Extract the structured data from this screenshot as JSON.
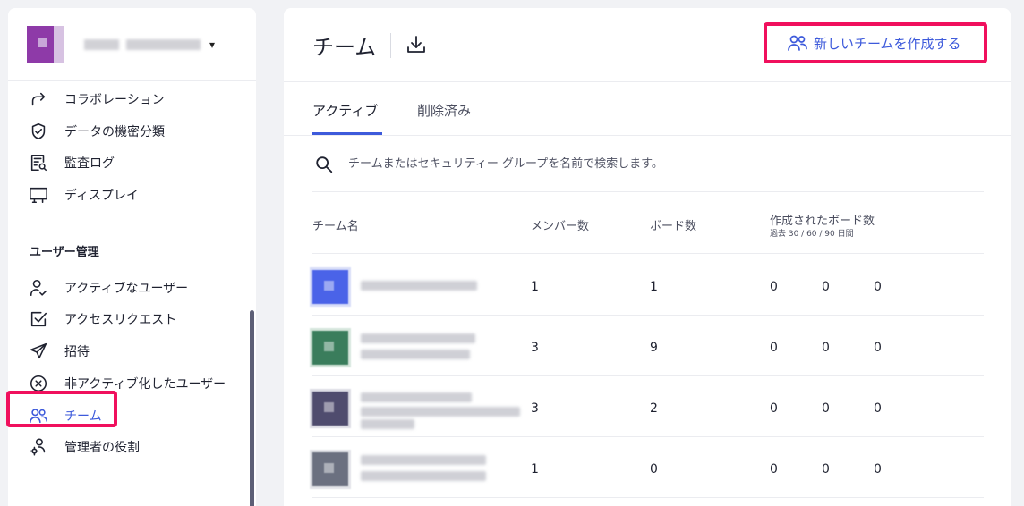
{
  "sidebar": {
    "account_chevron": "▾",
    "nav_top": [
      {
        "label": "コラボレーション",
        "icon": "share-arrow-icon"
      },
      {
        "label": "データの機密分類",
        "icon": "shield-check-icon"
      },
      {
        "label": "監査ログ",
        "icon": "audit-log-icon"
      },
      {
        "label": "ディスプレイ",
        "icon": "display-icon"
      }
    ],
    "section_title": "ユーザー管理",
    "nav_users": [
      {
        "label": "アクティブなユーザー",
        "icon": "user-check-icon"
      },
      {
        "label": "アクセスリクエスト",
        "icon": "checkbox-icon"
      },
      {
        "label": "招待",
        "icon": "send-icon"
      },
      {
        "label": "非アクティブ化したユーザー",
        "icon": "circle-x-icon"
      },
      {
        "label": "チーム",
        "icon": "users-icon",
        "active": true
      },
      {
        "label": "管理者の役割",
        "icon": "user-gear-icon"
      }
    ]
  },
  "header": {
    "title": "チーム",
    "create_button": "新しいチームを作成する"
  },
  "tabs": [
    {
      "label": "アクティブ",
      "active": true
    },
    {
      "label": "削除済み",
      "active": false
    }
  ],
  "search": {
    "placeholder": "チームまたはセキュリティー グループを名前で検索します。"
  },
  "table": {
    "columns": {
      "name": "チーム名",
      "members": "メンバー数",
      "boards": "ボード数",
      "created": "作成されたボード数",
      "created_sub": "過去 30 / 60 / 90 日間"
    },
    "rows": [
      {
        "color": "#4a63e8",
        "members": "1",
        "boards": "1",
        "d30": "0",
        "d60": "0",
        "d90": "0"
      },
      {
        "color": "#3a7d5c",
        "members": "3",
        "boards": "9",
        "d30": "0",
        "d60": "0",
        "d90": "0"
      },
      {
        "color": "#4f4c6e",
        "members": "3",
        "boards": "2",
        "d30": "0",
        "d60": "0",
        "d90": "0"
      },
      {
        "color": "#6b7080",
        "members": "1",
        "boards": "0",
        "d30": "0",
        "d60": "0",
        "d90": "0"
      }
    ]
  },
  "colors": {
    "accent": "#3d5adb",
    "highlight": "#f0105d"
  }
}
